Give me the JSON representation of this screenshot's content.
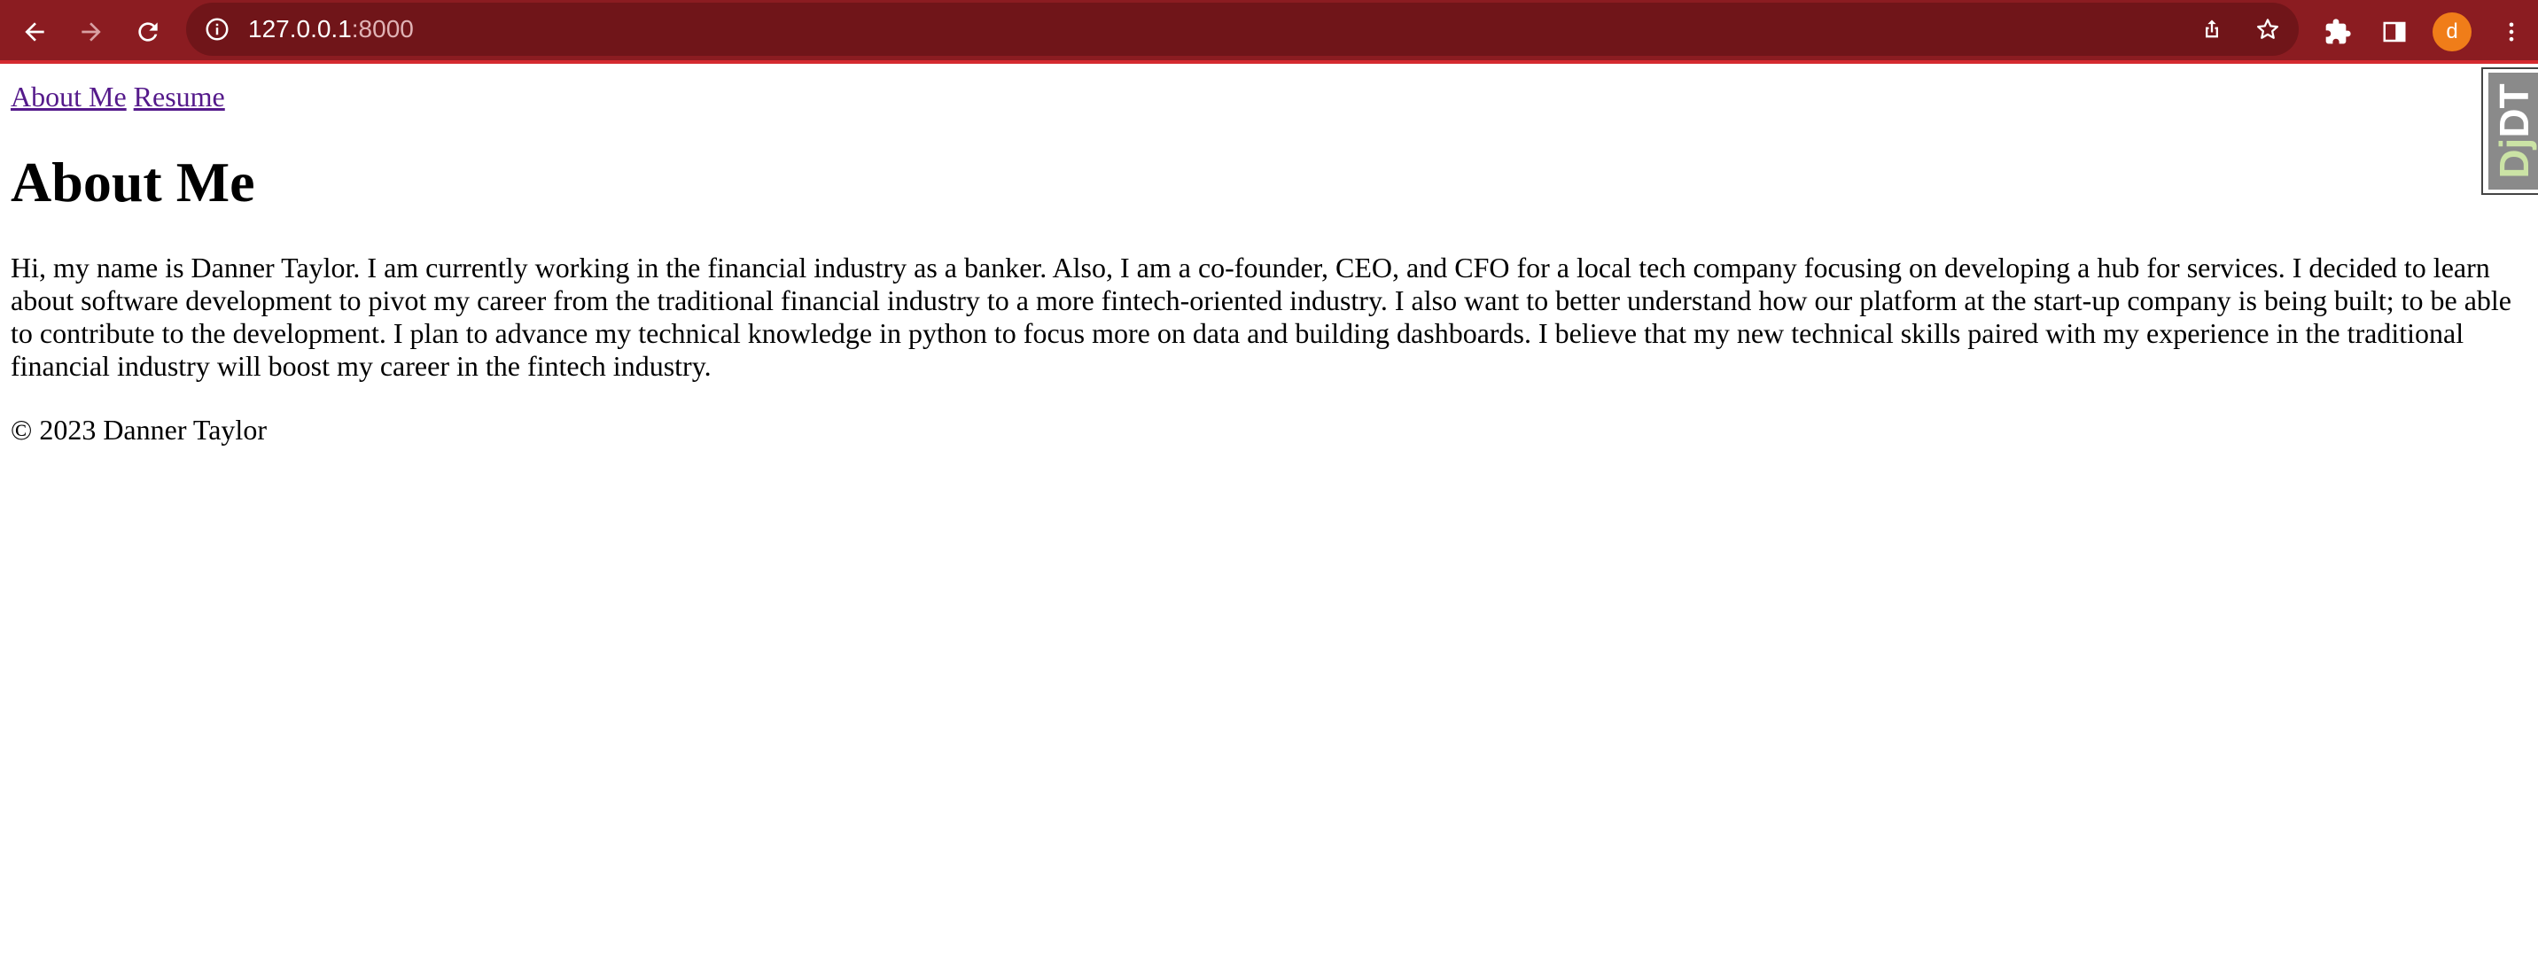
{
  "browser": {
    "url_host": "127.0.0.1",
    "url_port": ":8000",
    "profile_initial": "d",
    "theme_color": "#8b1c21",
    "icons": [
      "back-arrow-icon",
      "forward-arrow-icon",
      "reload-icon",
      "info-icon",
      "share-icon",
      "star-icon",
      "extensions-puzzle-icon",
      "side-panel-icon",
      "more-vert-icon"
    ]
  },
  "nav": {
    "about_label": "About Me",
    "resume_label": "Resume"
  },
  "main": {
    "title": "About Me",
    "bio": "Hi, my name is Danner Taylor. I am currently working in the financial industry as a banker. Also, I am a co-founder, CEO, and CFO for a local tech company focusing on developing a hub for services. I decided to learn about software development to pivot my career from the traditional financial industry to a more fintech-oriented industry. I also want to better understand how our platform at the start-up company is being built; to be able to contribute to the development. I plan to advance my technical knowledge in python to focus more on data and building dashboards. I believe that my new technical skills paired with my experience in the traditional financial industry will boost my career in the fintech industry."
  },
  "footer": {
    "text": "© 2023 Danner Taylor"
  },
  "djdt": {
    "label_dj": "Dj",
    "label_dt": "DT"
  }
}
